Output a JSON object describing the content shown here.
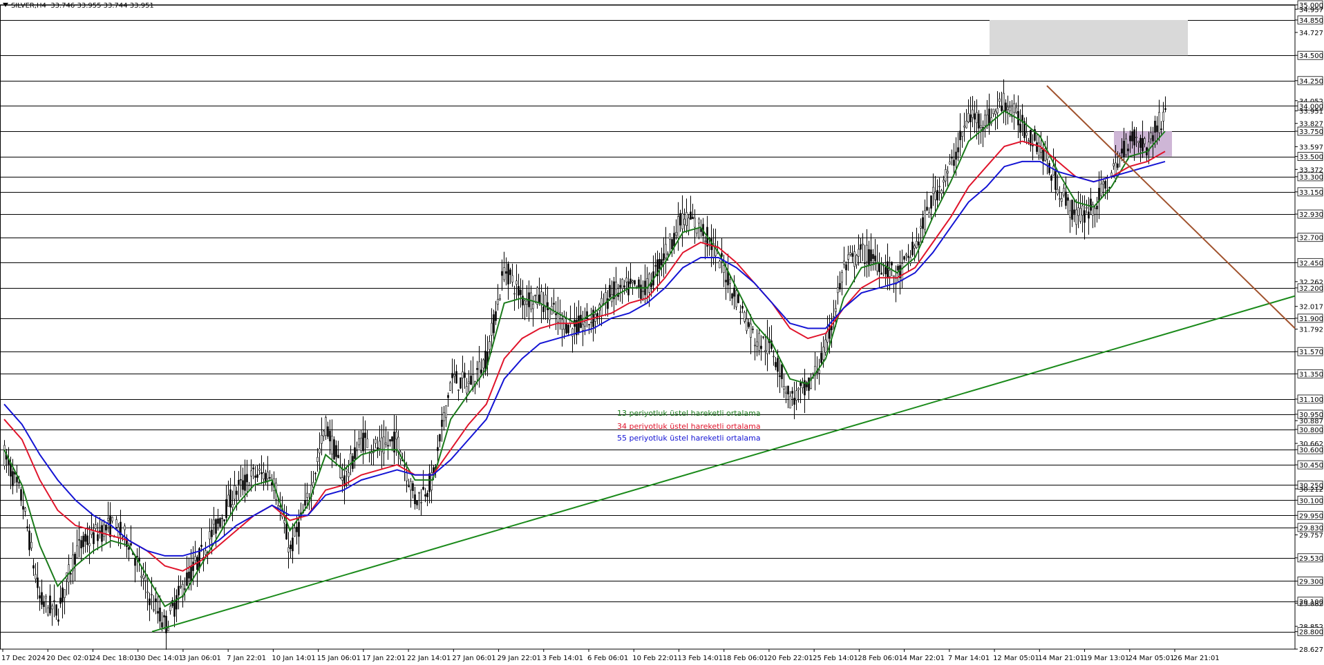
{
  "header": {
    "symbol": "SILVER,H4",
    "ohlc": "33.746 33.955 33.744 33.951"
  },
  "legend": [
    {
      "label": "13 periyotluk üstel hareketli ortalama",
      "color": "#1a7a1a"
    },
    {
      "label": "34 periyotluk üstel hareketli ortalama",
      "color": "#e0142b"
    },
    {
      "label": "55 periyotluk üstel hareketli ortalama",
      "color": "#1414d4"
    }
  ],
  "chart_data": {
    "type": "candlestick",
    "ylim": [
      28.627,
      35.0
    ],
    "x_tick_labels": [
      "17 Dec 2024",
      "20 Dec 02:01",
      "24 Dec 18:01",
      "30 Dec 14:01",
      "3 Jan 06:01",
      "7 Jan 22:01",
      "10 Jan 14:01",
      "15 Jan 06:01",
      "17 Jan 22:01",
      "22 Jan 14:01",
      "27 Jan 06:01",
      "29 Jan 22:01",
      "3 Feb 14:01",
      "6 Feb 06:01",
      "10 Feb 22:01",
      "13 Feb 14:01",
      "18 Feb 06:01",
      "20 Feb 22:01",
      "25 Feb 14:01",
      "28 Feb 06:01",
      "4 Mar 22:01",
      "7 Mar 14:01",
      "12 Mar 05:01",
      "14 Mar 21:01",
      "19 Mar 13:01",
      "24 Mar 05:01",
      "26 Mar 21:01"
    ],
    "y_tick_labels": [
      "35.000",
      "34.957",
      "34.850",
      "34.727",
      "34.500",
      "34.250",
      "34.052",
      "34.000",
      "33.951",
      "33.827",
      "33.750",
      "33.597",
      "33.500",
      "33.372",
      "33.300",
      "33.150",
      "32.930",
      "32.700",
      "32.450",
      "32.262",
      "32.200",
      "32.017",
      "31.900",
      "31.792",
      "31.570",
      "31.350",
      "31.100",
      "30.950",
      "30.887",
      "30.800",
      "30.662",
      "30.600",
      "30.450",
      "30.250",
      "30.212",
      "30.100",
      "29.950",
      "29.830",
      "29.757",
      "29.530",
      "29.300",
      "29.100",
      "29.082",
      "28.852",
      "28.800",
      "28.627"
    ],
    "horizontal_levels": [
      35.0,
      34.85,
      34.5,
      34.25,
      34.0,
      33.75,
      33.5,
      33.3,
      33.15,
      32.93,
      32.7,
      32.45,
      32.2,
      31.9,
      31.57,
      31.35,
      31.1,
      30.95,
      30.8,
      30.6,
      30.45,
      30.25,
      30.1,
      29.95,
      29.83,
      29.53,
      29.3,
      29.1,
      28.8
    ],
    "close_path": [
      [
        "17 Dec 2024",
        30.55
      ],
      [
        "19 Dec",
        30.1
      ],
      [
        "20 Dec 02:01",
        29.1
      ],
      [
        "21 Dec",
        29.0
      ],
      [
        "23 Dec",
        29.6
      ],
      [
        "24 Dec 18:01",
        29.75
      ],
      [
        "26 Dec",
        29.85
      ],
      [
        "27 Dec",
        29.7
      ],
      [
        "30 Dec",
        29.2
      ],
      [
        "30 Dec 14:01",
        28.85
      ],
      [
        "31 Dec",
        29.25
      ],
      [
        "3 Jan 06:01",
        29.55
      ],
      [
        "6 Jan",
        29.9
      ],
      [
        "7 Jan 22:01",
        30.2
      ],
      [
        "9 Jan",
        30.35
      ],
      [
        "10 Jan 14:01",
        30.35
      ],
      [
        "13 Jan",
        29.6
      ],
      [
        "15 Jan 06:01",
        30.1
      ],
      [
        "16 Jan",
        30.85
      ],
      [
        "17 Jan 22:01",
        30.3
      ],
      [
        "21 Jan",
        30.7
      ],
      [
        "22 Jan 14:01",
        30.6
      ],
      [
        "24 Jan",
        30.7
      ],
      [
        "27 Jan 06:01",
        30.1
      ],
      [
        "28 Jan",
        30.3
      ],
      [
        "29 Jan 22:01",
        31.3
      ],
      [
        "31 Jan",
        31.25
      ],
      [
        "3 Feb 14:01",
        31.5
      ],
      [
        "4 Feb",
        32.4
      ],
      [
        "5 Feb",
        32.1
      ],
      [
        "6 Feb 06:01",
        32.1
      ],
      [
        "7 Feb",
        31.9
      ],
      [
        "10 Feb 22:01",
        31.8
      ],
      [
        "12 Feb",
        31.9
      ],
      [
        "13 Feb 14:01",
        32.15
      ],
      [
        "14 Feb",
        32.2
      ],
      [
        "17 Feb",
        32.2
      ],
      [
        "18 Feb 06:01",
        32.55
      ],
      [
        "19 Feb",
        32.9
      ],
      [
        "20 Feb 22:01",
        32.8
      ],
      [
        "21 Feb",
        32.5
      ],
      [
        "24 Feb",
        32.1
      ],
      [
        "25 Feb 14:01",
        31.7
      ],
      [
        "26 Feb",
        31.6
      ],
      [
        "27 Feb",
        31.1
      ],
      [
        "28 Feb 06:01",
        31.2
      ],
      [
        "3 Mar",
        31.6
      ],
      [
        "4 Mar 22:01",
        32.4
      ],
      [
        "5 Mar",
        32.55
      ],
      [
        "6 Mar",
        32.45
      ],
      [
        "7 Mar 14:01",
        32.3
      ],
      [
        "10 Mar",
        32.6
      ],
      [
        "11 Mar",
        33.1
      ],
      [
        "12 Mar 05:01",
        33.4
      ],
      [
        "13 Mar",
        33.9
      ],
      [
        "14 Mar 21:01",
        33.85
      ],
      [
        "17 Mar",
        34.05
      ],
      [
        "18 Mar",
        33.8
      ],
      [
        "19 Mar 13:01",
        33.6
      ],
      [
        "20 Mar",
        33.2
      ],
      [
        "21 Mar",
        32.9
      ],
      [
        "24 Mar 05:01",
        33.0
      ],
      [
        "25 Mar",
        33.3
      ],
      [
        "26 Mar",
        33.7
      ],
      [
        "26 Mar 21:01",
        33.6
      ],
      [
        "27 Mar",
        33.95
      ]
    ],
    "series": [
      {
        "name": "13 periyotluk üstel hareketli ortalama",
        "color": "#1a7a1a",
        "values": [
          30.6,
          30.25,
          29.65,
          29.25,
          29.45,
          29.6,
          29.7,
          29.65,
          29.35,
          29.05,
          29.15,
          29.45,
          29.75,
          30.05,
          30.25,
          30.3,
          29.8,
          30.05,
          30.55,
          30.4,
          30.55,
          30.6,
          30.6,
          30.3,
          30.3,
          30.9,
          31.15,
          31.4,
          32.05,
          32.1,
          32.05,
          31.95,
          31.85,
          31.95,
          32.1,
          32.2,
          32.2,
          32.45,
          32.75,
          32.8,
          32.55,
          32.2,
          31.85,
          31.65,
          31.3,
          31.25,
          31.5,
          32.1,
          32.4,
          32.45,
          32.35,
          32.5,
          32.9,
          33.25,
          33.65,
          33.8,
          33.95,
          33.85,
          33.7,
          33.35,
          33.05,
          33.0,
          33.2,
          33.5,
          33.55,
          33.75
        ]
      },
      {
        "name": "34 periyotluk üstel hareketli ortalama",
        "color": "#e0142b",
        "values": [
          30.9,
          30.7,
          30.3,
          30.0,
          29.85,
          29.8,
          29.75,
          29.7,
          29.6,
          29.45,
          29.4,
          29.5,
          29.65,
          29.8,
          29.95,
          30.05,
          29.9,
          29.95,
          30.2,
          30.25,
          30.35,
          30.4,
          30.45,
          30.35,
          30.35,
          30.6,
          30.85,
          31.05,
          31.5,
          31.7,
          31.8,
          31.85,
          31.85,
          31.9,
          31.95,
          32.05,
          32.1,
          32.3,
          32.55,
          32.65,
          32.6,
          32.45,
          32.25,
          32.05,
          31.8,
          31.7,
          31.75,
          32.0,
          32.2,
          32.3,
          32.3,
          32.4,
          32.65,
          32.9,
          33.2,
          33.4,
          33.6,
          33.65,
          33.6,
          33.45,
          33.3,
          33.25,
          33.3,
          33.4,
          33.45,
          33.55
        ]
      },
      {
        "name": "55 periyotluk üstel hareketli ortalama",
        "color": "#1414d4",
        "values": [
          31.05,
          30.85,
          30.55,
          30.3,
          30.1,
          29.95,
          29.85,
          29.7,
          29.6,
          29.55,
          29.55,
          29.6,
          29.7,
          29.85,
          29.95,
          30.05,
          29.95,
          29.95,
          30.15,
          30.2,
          30.3,
          30.35,
          30.4,
          30.35,
          30.35,
          30.5,
          30.7,
          30.9,
          31.3,
          31.5,
          31.65,
          31.7,
          31.75,
          31.8,
          31.9,
          31.95,
          32.05,
          32.2,
          32.4,
          32.5,
          32.5,
          32.4,
          32.25,
          32.05,
          31.85,
          31.8,
          31.8,
          32.0,
          32.15,
          32.2,
          32.25,
          32.35,
          32.55,
          32.8,
          33.05,
          33.2,
          33.4,
          33.45,
          33.45,
          33.35,
          33.3,
          33.25,
          33.3,
          33.35,
          33.4,
          33.45
        ]
      }
    ]
  }
}
